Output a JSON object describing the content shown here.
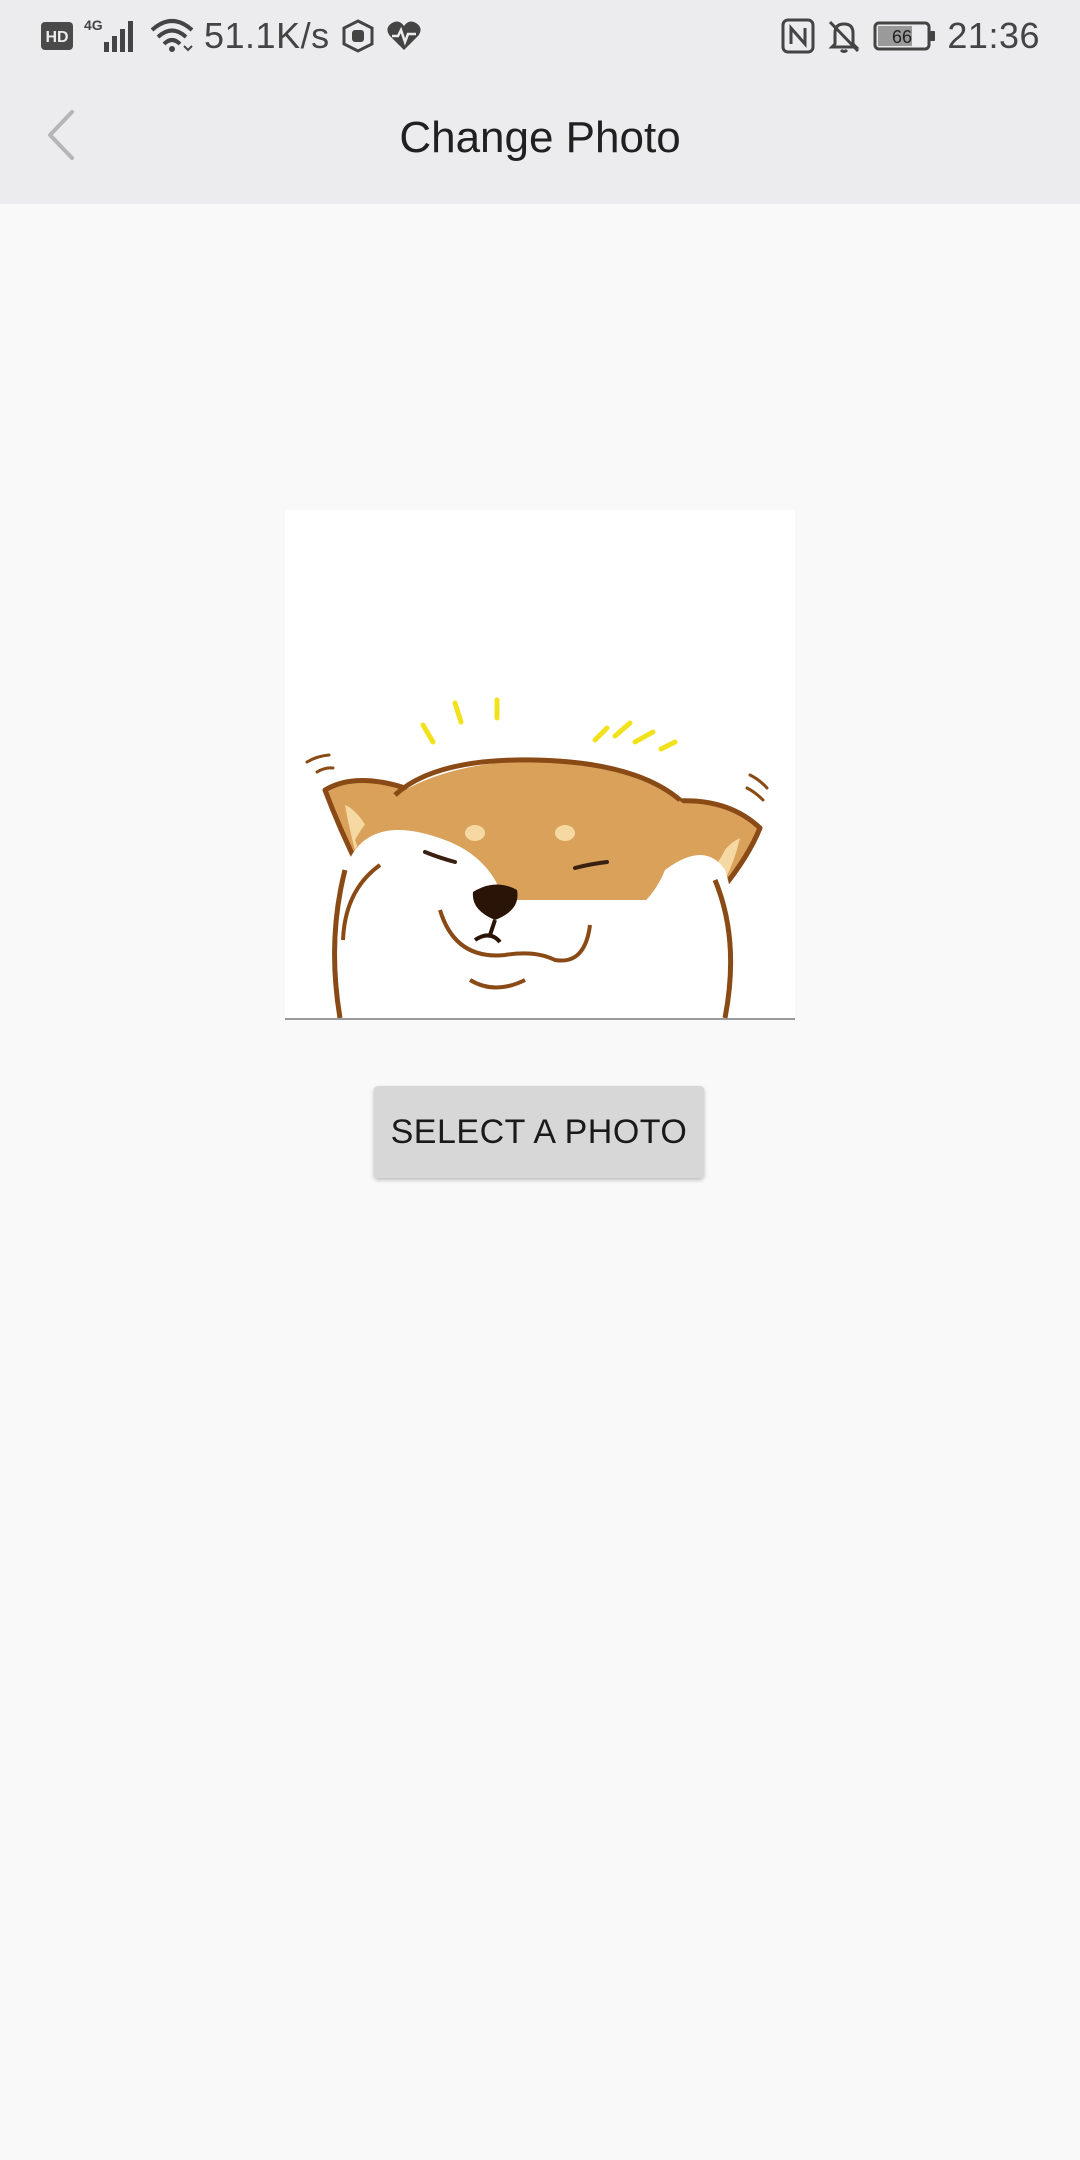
{
  "status_bar": {
    "network_badge": "HD",
    "network_type": "4G",
    "speed": "51.1K/s",
    "battery_level": "66",
    "time": "21:36",
    "icons_left": [
      "hd-badge-icon",
      "signal-4g-icon",
      "wifi-icon",
      "shield-app-icon",
      "heart-rate-icon"
    ],
    "icons_right": [
      "nfc-icon",
      "bell-off-icon",
      "battery-icon"
    ]
  },
  "app_bar": {
    "title": "Change Photo",
    "back_icon": "chevron-left-icon"
  },
  "photo": {
    "subject": "shiba-inu-illustration"
  },
  "actions": {
    "select_label": "SELECT A PHOTO"
  },
  "colors": {
    "bar_background": "#ececee",
    "page_background": "#f9f9f9",
    "button_background": "#d7d7d7",
    "dog_fur": "#d9a15a",
    "dog_outline": "#8a4a16",
    "sparkle": "#f2e21c"
  }
}
